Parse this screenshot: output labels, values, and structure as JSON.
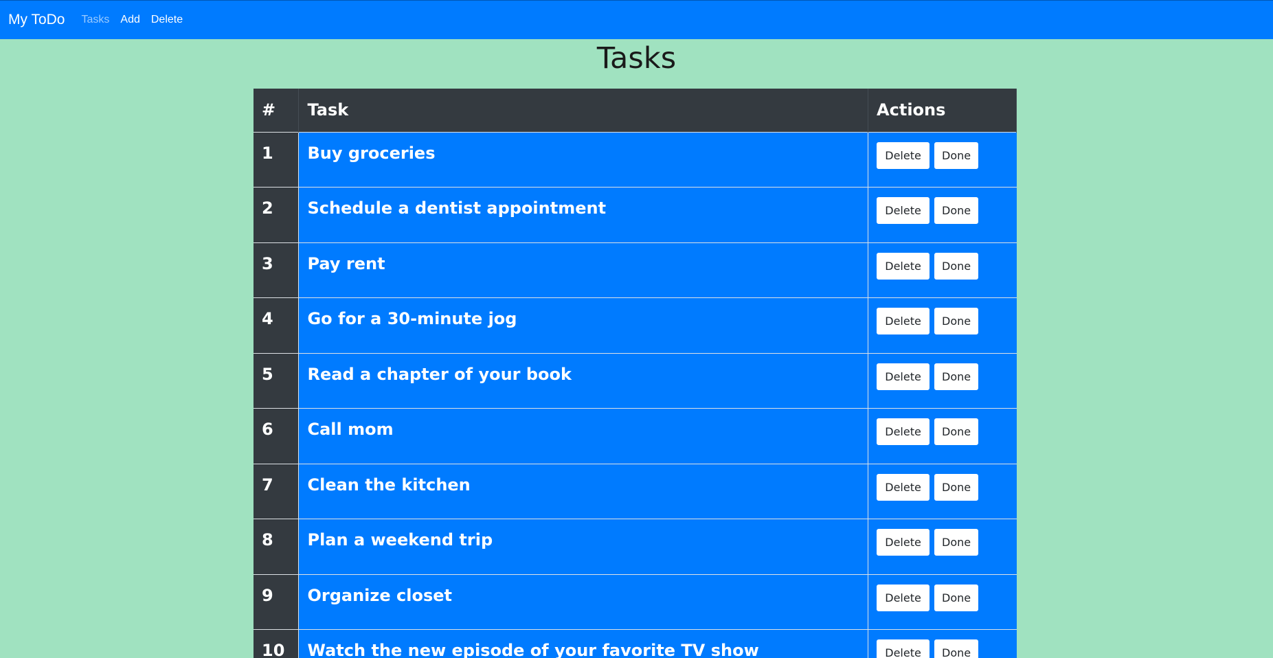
{
  "navbar": {
    "brand": "My ToDo",
    "links": [
      {
        "label": "Tasks",
        "active": true
      },
      {
        "label": "Add",
        "active": false
      },
      {
        "label": "Delete",
        "active": false
      }
    ]
  },
  "page": {
    "title": "Tasks"
  },
  "table": {
    "headers": [
      "#",
      "Task",
      "Actions"
    ],
    "delete_label": "Delete",
    "done_label": "Done",
    "rows": [
      {
        "num": "1",
        "task": "Buy groceries"
      },
      {
        "num": "2",
        "task": "Schedule a dentist appointment"
      },
      {
        "num": "3",
        "task": "Pay rent"
      },
      {
        "num": "4",
        "task": "Go for a 30-minute jog"
      },
      {
        "num": "5",
        "task": "Read a chapter of your book"
      },
      {
        "num": "6",
        "task": "Call mom"
      },
      {
        "num": "7",
        "task": "Clean the kitchen"
      },
      {
        "num": "8",
        "task": "Plan a weekend trip"
      },
      {
        "num": "9",
        "task": "Organize closet"
      },
      {
        "num": "10",
        "task": "Watch the new episode of your favorite TV show"
      }
    ]
  },
  "colors": {
    "background": "#a0e2c0",
    "navbar": "#007bff",
    "table_header": "#343a40",
    "row": "#007bff"
  }
}
